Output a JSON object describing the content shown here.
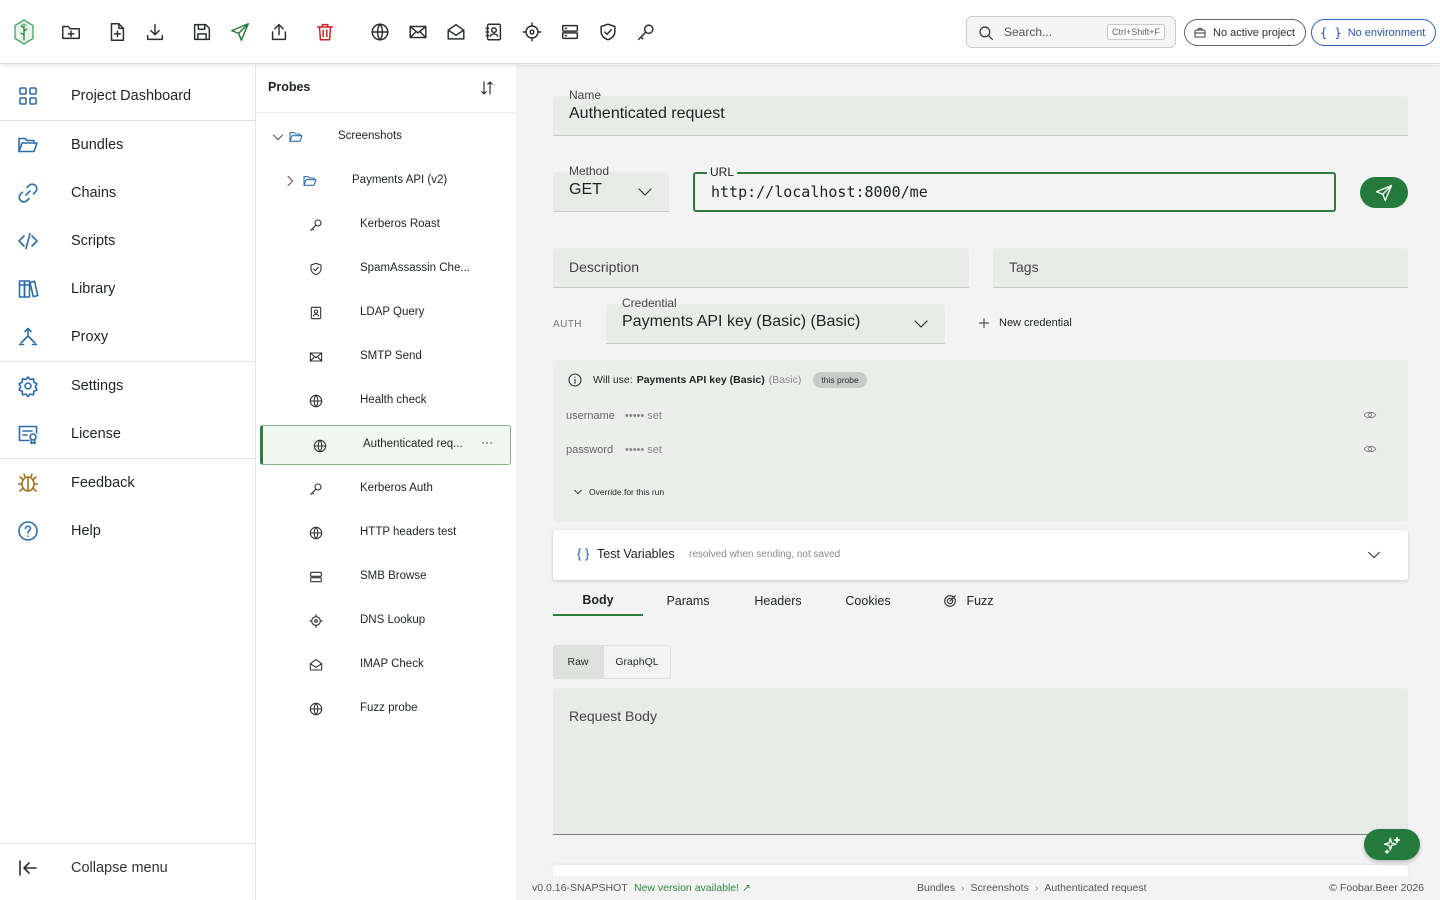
{
  "toolbar": {
    "search_placeholder": "Search...",
    "search_shortcut": "Ctrl+Shift+F",
    "project_pill": "No active project",
    "environment_pill": "No environment"
  },
  "nav": {
    "items": [
      {
        "label": "Project Dashboard",
        "icon": "grid-icon"
      },
      {
        "label": "Bundles",
        "icon": "folder-open-icon"
      },
      {
        "label": "Chains",
        "icon": "link-icon"
      },
      {
        "label": "Scripts",
        "icon": "code-icon"
      },
      {
        "label": "Library",
        "icon": "books-icon"
      },
      {
        "label": "Proxy",
        "icon": "proxy-icon"
      },
      {
        "label": "Settings",
        "icon": "gear-icon"
      },
      {
        "label": "License",
        "icon": "certificate-icon"
      },
      {
        "label": "Feedback",
        "icon": "bug-icon"
      },
      {
        "label": "Help",
        "icon": "help-icon"
      }
    ],
    "collapse_label": "Collapse menu"
  },
  "probes": {
    "title": "Probes",
    "root_folder": "Screenshots",
    "sub_folder": "Payments API (v2)",
    "items": [
      {
        "label": "Kerberos Roast",
        "icon": "key-icon"
      },
      {
        "label": "SpamAssassin Che...",
        "icon": "shield-check-icon"
      },
      {
        "label": "LDAP Query",
        "icon": "contact-book-icon"
      },
      {
        "label": "SMTP Send",
        "icon": "mail-icon"
      },
      {
        "label": "Health check",
        "icon": "globe-icon"
      },
      {
        "label": "Authenticated req...",
        "icon": "globe-icon"
      },
      {
        "label": "Kerberos Auth",
        "icon": "key-icon"
      },
      {
        "label": "HTTP headers test",
        "icon": "globe-icon"
      },
      {
        "label": "SMB Browse",
        "icon": "server-icon"
      },
      {
        "label": "DNS Lookup",
        "icon": "crosshair-icon"
      },
      {
        "label": "IMAP Check",
        "icon": "mail-open-icon"
      },
      {
        "label": "Fuzz probe",
        "icon": "globe-icon"
      }
    ],
    "more_label": "···"
  },
  "editor": {
    "name_label": "Name",
    "name_value": "Authenticated request",
    "method_label": "Method",
    "method_value": "GET",
    "url_label": "URL",
    "url_value": "http://localhost:8000/me",
    "description_placeholder": "Description",
    "tags_placeholder": "Tags",
    "auth_label": "AUTH",
    "credential_label": "Credential",
    "credential_value": "Payments API key (Basic) (Basic)",
    "new_credential": "New credential",
    "will_use_prefix": "Will use:",
    "will_use_name": "Payments API key (Basic)",
    "will_use_type": "(Basic)",
    "will_use_chip": "this probe",
    "username_key": "username",
    "username_value": "••••• set",
    "password_key": "password",
    "password_value": "••••• set",
    "override_label": "Override for this run",
    "test_vars_brace": "{ }",
    "test_vars_title": "Test Variables",
    "test_vars_sub": "resolved when sending, not saved",
    "tabs": {
      "body": "Body",
      "params": "Params",
      "headers": "Headers",
      "cookies": "Cookies",
      "fuzz": "Fuzz"
    },
    "raw_label": "Raw",
    "graphql_label": "GraphQL",
    "body_placeholder": "Request Body"
  },
  "statusbar": {
    "version": "v0.0.16-SNAPSHOT",
    "new_version": "New version available! ↗",
    "crumbs": [
      "Bundles",
      "Screenshots",
      "Authenticated request"
    ],
    "crumb_sep": "›",
    "copyright": "© Foobar.Beer 2026"
  },
  "colors": {
    "accent": "#237a3a",
    "nav_icon": "#2e6ea8",
    "environment": "#2257a6",
    "delete": "#cc2222"
  }
}
